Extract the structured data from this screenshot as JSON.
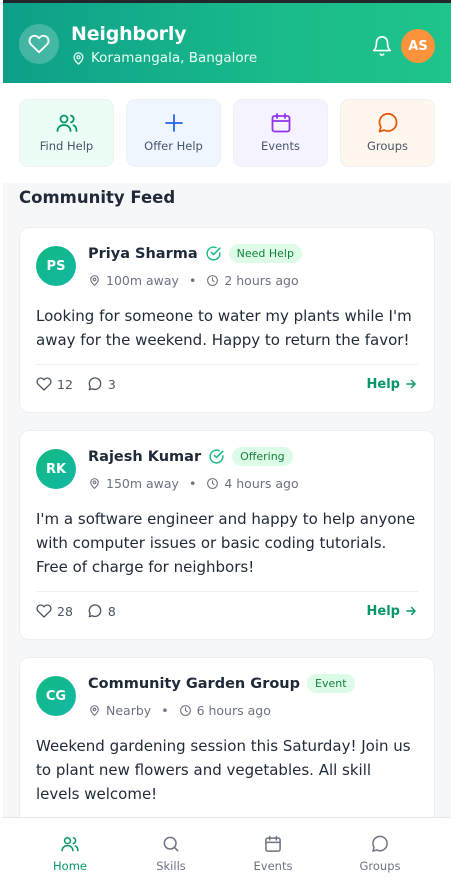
{
  "app": {
    "name": "Neighborly",
    "location": "Koramangala, Bangalore",
    "user_initials": "AS"
  },
  "quick_actions": [
    {
      "label": "Find Help",
      "icon": "users-icon"
    },
    {
      "label": "Offer Help",
      "icon": "plus-icon"
    },
    {
      "label": "Events",
      "icon": "calendar-icon"
    },
    {
      "label": "Groups",
      "icon": "chat-icon"
    }
  ],
  "feed": {
    "title": "Community Feed",
    "posts": [
      {
        "initials": "PS",
        "author": "Priya Sharma",
        "verified": true,
        "tag": "Need Help",
        "distance": "100m away",
        "time": "2 hours ago",
        "text": "Looking for someone to water my plants while I'm away for the weekend. Happy to return the favor!",
        "likes": "12",
        "comments": "3",
        "action": "Help"
      },
      {
        "initials": "RK",
        "author": "Rajesh Kumar",
        "verified": true,
        "tag": "Offering",
        "distance": "150m away",
        "time": "4 hours ago",
        "text": "I'm a software engineer and happy to help anyone with computer issues or basic coding tutorials. Free of charge for neighbors!",
        "likes": "28",
        "comments": "8",
        "action": "Help"
      },
      {
        "initials": "CG",
        "author": "Community Garden Group",
        "verified": false,
        "tag": "Event",
        "distance": "Nearby",
        "time": "6 hours ago",
        "text": "Weekend gardening session this Saturday! Join us to plant new flowers and vegetables. All skill levels welcome!"
      }
    ]
  },
  "tabs": [
    {
      "label": "Home",
      "icon": "users-icon",
      "active": true
    },
    {
      "label": "Skills",
      "icon": "search-icon",
      "active": false
    },
    {
      "label": "Events",
      "icon": "calendar-icon",
      "active": false
    },
    {
      "label": "Groups",
      "icon": "chat-icon",
      "active": false
    }
  ],
  "colors": {
    "brand": "#10b981",
    "brand_dark": "#0d9f8a",
    "avatar_user": "#fb923c",
    "accent_green_text": "#059669"
  }
}
